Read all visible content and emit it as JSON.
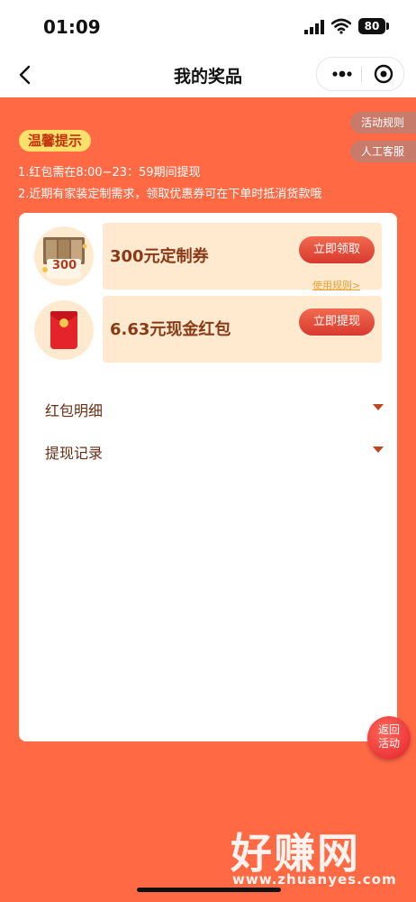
{
  "status_bar": {
    "time": "01:09",
    "battery": "80"
  },
  "nav": {
    "title": "我的奖品"
  },
  "tips": {
    "badge": "温馨提示",
    "line1": "1.红包需在8:00−23：59期间提现",
    "line2": "2.近期有家装定制需求，领取优惠券可在下单时抵消货款哦"
  },
  "side_buttons": {
    "rules": "活动规则",
    "service": "人工客服"
  },
  "prizes": [
    {
      "title": "300元定制券",
      "button": "立即领取",
      "link": "使用规则>",
      "thumb_text": "300"
    },
    {
      "title": "6.63元现金红包",
      "button": "立即提现"
    }
  ],
  "sections": [
    {
      "label": "红包明细"
    },
    {
      "label": "提现记录"
    }
  ],
  "float_button": {
    "line1": "返回",
    "line2": "活动"
  },
  "watermark": {
    "main": "好赚网",
    "url": "www.zhuanyes.com"
  },
  "colors": {
    "background": "#ff6a45",
    "accent": "#d8392e",
    "card": "#ffffff"
  }
}
